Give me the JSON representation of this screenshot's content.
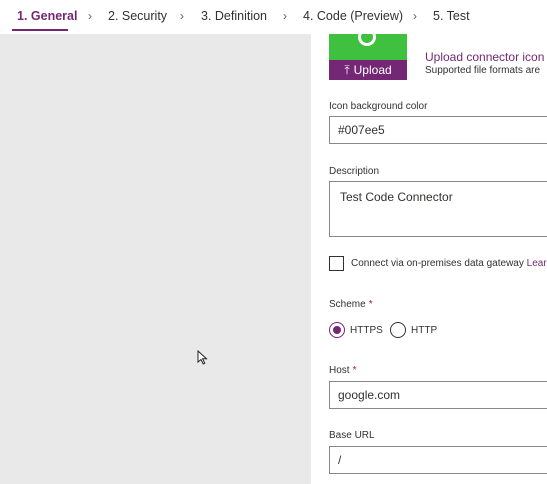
{
  "steps": [
    {
      "label": "1. General",
      "active": true
    },
    {
      "label": "2. Security",
      "active": false
    },
    {
      "label": "3. Definition",
      "active": false
    },
    {
      "label": "4. Code (Preview)",
      "active": false
    },
    {
      "label": "5. Test",
      "active": false
    }
  ],
  "icon": {
    "upload_button_label": "Upload",
    "upload_link": "Upload connector icon",
    "supported_formats": "Supported file formats are",
    "preview_color": "#3fc13f",
    "accent_color": "#742774"
  },
  "icon_bg": {
    "label": "Icon background color",
    "value": "#007ee5"
  },
  "description": {
    "label": "Description",
    "value": "Test Code Connector"
  },
  "gateway": {
    "label": "Connect via on-premises data gateway",
    "learn_more": "Learn m",
    "checked": false
  },
  "scheme": {
    "label": "Scheme",
    "required_mark": "*",
    "options": [
      {
        "label": "HTTPS",
        "selected": true
      },
      {
        "label": "HTTP",
        "selected": false
      }
    ]
  },
  "host": {
    "label": "Host",
    "required_mark": "*",
    "value": "google.com"
  },
  "base_url": {
    "label": "Base URL",
    "value": "/"
  }
}
